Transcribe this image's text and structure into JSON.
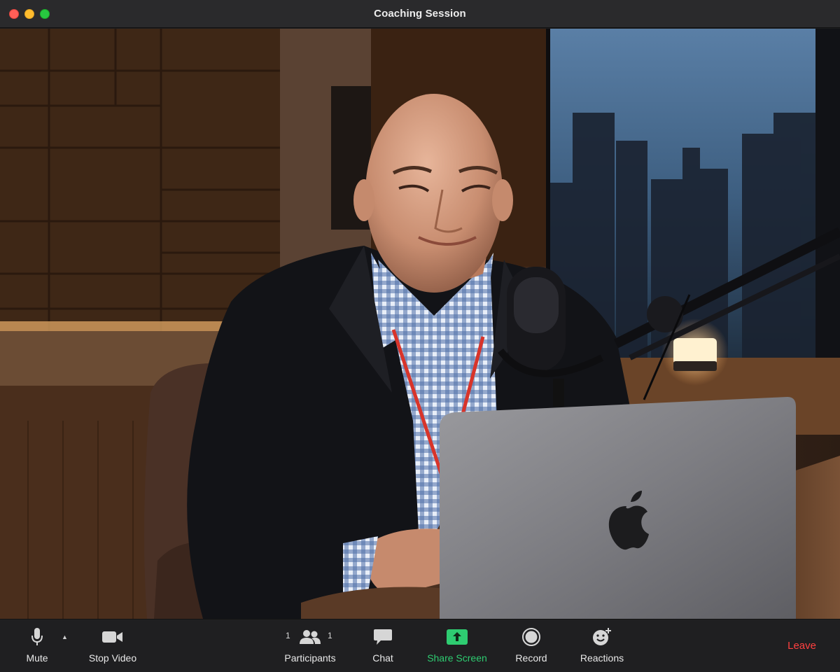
{
  "window": {
    "title": "Coaching Session"
  },
  "toolbar": {
    "mute_label": "Mute",
    "stop_video_label": "Stop Video",
    "participants_label": "Participants",
    "participants_count_left": "1",
    "participants_count_right": "1",
    "chat_label": "Chat",
    "share_screen_label": "Share Screen",
    "record_label": "Record",
    "reactions_label": "Reactions",
    "leave_label": "Leave"
  },
  "icons": {
    "mute": "microphone-icon",
    "stop_video": "video-camera-icon",
    "participants": "participants-icon",
    "chat": "chat-bubble-icon",
    "share_screen": "share-screen-icon",
    "record": "record-icon",
    "reactions": "smiley-icon"
  },
  "colors": {
    "share_accent": "#2ecc71",
    "leave": "#ff4040",
    "toolbar_bg": "#1f1f21",
    "titlebar_bg": "#2a2a2c"
  }
}
